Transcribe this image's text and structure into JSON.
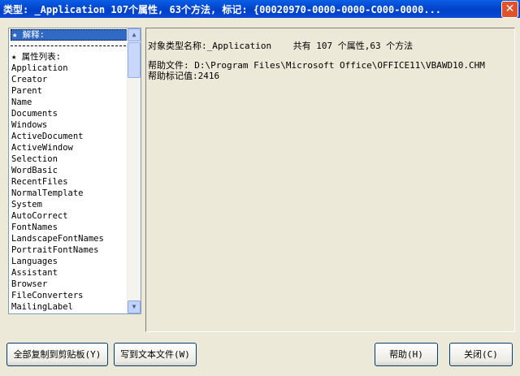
{
  "window": {
    "title": "类型: _Application  107个属性, 63个方法, 标记: {00020970-0000-0000-C000-0000...",
    "close_glyph": "✕"
  },
  "list": {
    "header1": "★ 解释:",
    "header2": "★ 属性列表:",
    "items": [
      "Application",
      "Creator",
      "Parent",
      "Name",
      "Documents",
      "Windows",
      "ActiveDocument",
      "ActiveWindow",
      "Selection",
      "WordBasic",
      "RecentFiles",
      "NormalTemplate",
      "System",
      "AutoCorrect",
      "FontNames",
      "LandscapeFontNames",
      "PortraitFontNames",
      "Languages",
      "Assistant",
      "Browser",
      "FileConverters",
      "MailingLabel"
    ]
  },
  "scrollbar": {
    "up": "▲",
    "down": "▼"
  },
  "info": {
    "line1": "对象类型名称:_Application    共有 107 个属性,63 个方法",
    "line2": "帮助文件: D:\\Program Files\\Microsoft Office\\OFFICE11\\VBAWD10.CHM",
    "line3": "帮助标记值:2416"
  },
  "buttons": {
    "copy_all": "全部复制到剪贴板(Y)",
    "write_file": "写到文本文件(W)",
    "help": "帮助(H)",
    "close": "关闭(C)"
  }
}
